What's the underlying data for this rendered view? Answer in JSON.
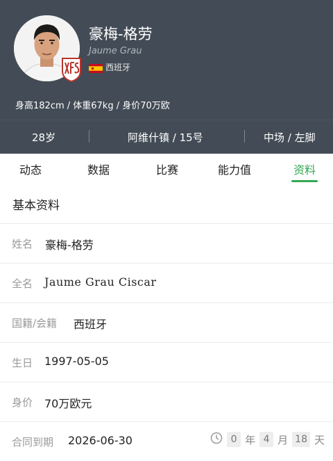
{
  "player": {
    "name": "豪梅-格劳",
    "name_en": "Jaume Grau",
    "nation": "西班牙",
    "body_info": "身高182cm / 体重67kg / 身价70万欧"
  },
  "stats": {
    "age": "28岁",
    "club": "阿维什镇 / 15号",
    "position": "中场 / 左脚"
  },
  "tabs": [
    {
      "label": "动态"
    },
    {
      "label": "数据"
    },
    {
      "label": "比赛"
    },
    {
      "label": "能力值"
    },
    {
      "label": "资料"
    }
  ],
  "active_tab": "资料",
  "section_title": "基本资料",
  "details": [
    {
      "label": "姓名",
      "value": "豪梅-格劳"
    },
    {
      "label": "全名",
      "value": "Jaume Grau Ciscar"
    },
    {
      "label": "国籍/会籍",
      "value": "西班牙"
    },
    {
      "label": "生日",
      "value": "1997-05-05"
    },
    {
      "label": "身价",
      "value": "70万欧元"
    },
    {
      "label": "合同到期",
      "value": "2026-06-30"
    }
  ],
  "countdown": {
    "years": "0",
    "years_unit": "年",
    "months": "4",
    "months_unit": "月",
    "days": "18",
    "days_unit": "天"
  },
  "colors": {
    "header_bg": "#434c56",
    "accent": "#34a853",
    "flag_red": "#c60b1e",
    "flag_yellow": "#ffc400"
  },
  "icons": [
    "avatar",
    "club-badge-icon",
    "spain-flag-icon",
    "clock-icon"
  ]
}
